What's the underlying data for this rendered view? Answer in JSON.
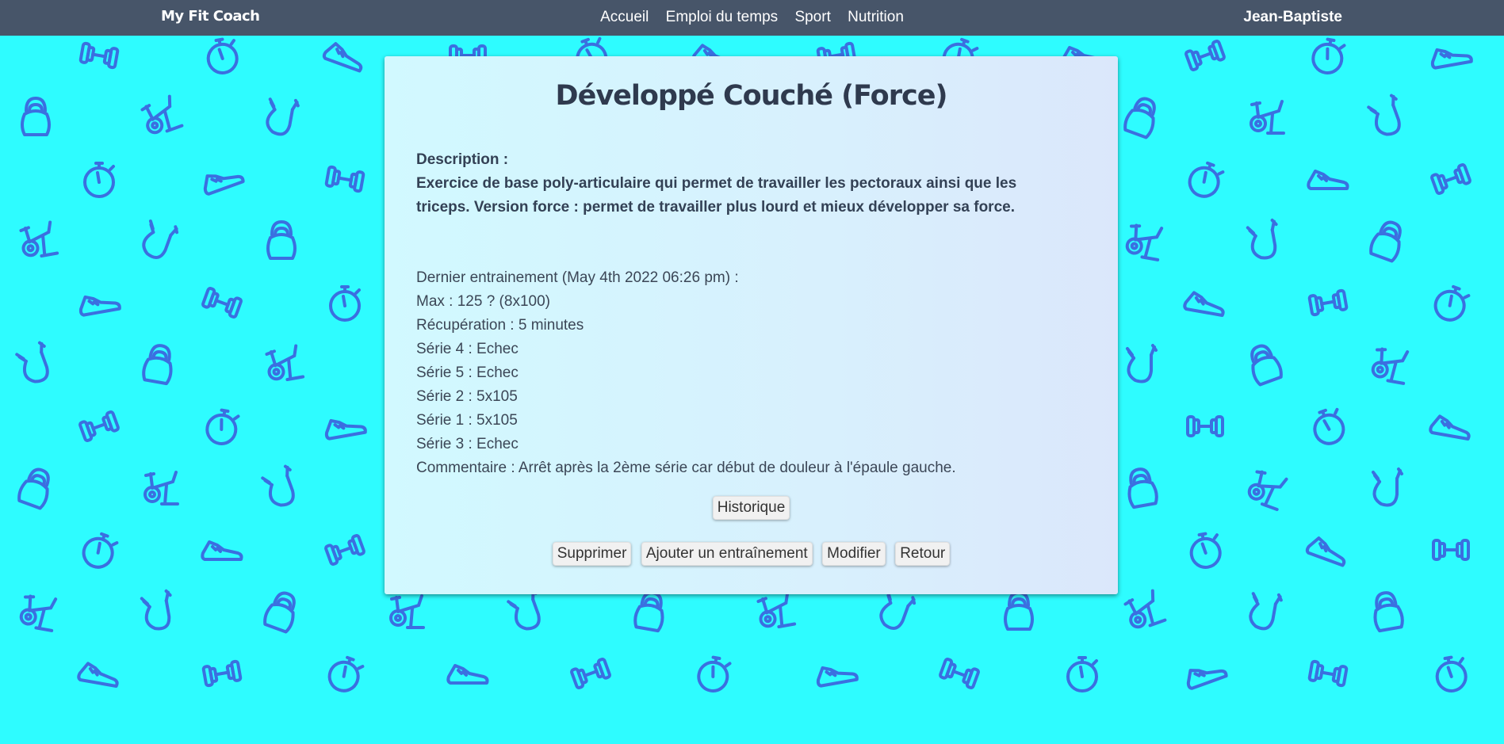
{
  "navbar": {
    "brand": "My Fit Coach",
    "links": [
      "Accueil",
      "Emploi du temps",
      "Sport",
      "Nutrition"
    ],
    "user": "Jean-Baptiste"
  },
  "exercise": {
    "title": "Développé Couché (Force)",
    "description_label": "Description :",
    "description_text": "Exercice de base poly-articulaire qui permet de travailler les pectoraux ainsi que les triceps. Version force : permet de travailler plus lourd et mieux développer sa force."
  },
  "last_training": {
    "header": "Dernier entrainement (May 4th 2022 06:26 pm) :",
    "max": "Max : 125 ? (8x100)",
    "recovery": "Récupération : 5 minutes",
    "series": [
      "Série 4 : Echec",
      "Série 5 : Echec",
      "Série 2 : 5x105",
      "Série 1 : 5x105",
      "Série 3 : Echec"
    ],
    "comment": "Commentaire : Arrêt après la 2ème série car début de douleur à l'épaule gauche."
  },
  "buttons": {
    "history": "Historique",
    "delete": "Supprimer",
    "add_training": "Ajouter un entraînement",
    "edit": "Modifier",
    "back": "Retour"
  },
  "background_icons": [
    "sneaker-icon",
    "kettlebell-icon",
    "dumbbell-icon",
    "exercise-bike-icon",
    "stopwatch-icon",
    "jump-rope-icon"
  ],
  "colors": {
    "background": "#2efcff",
    "pattern": "#3b6fe0",
    "navbar": "#475569",
    "title": "#2f3a4e"
  }
}
